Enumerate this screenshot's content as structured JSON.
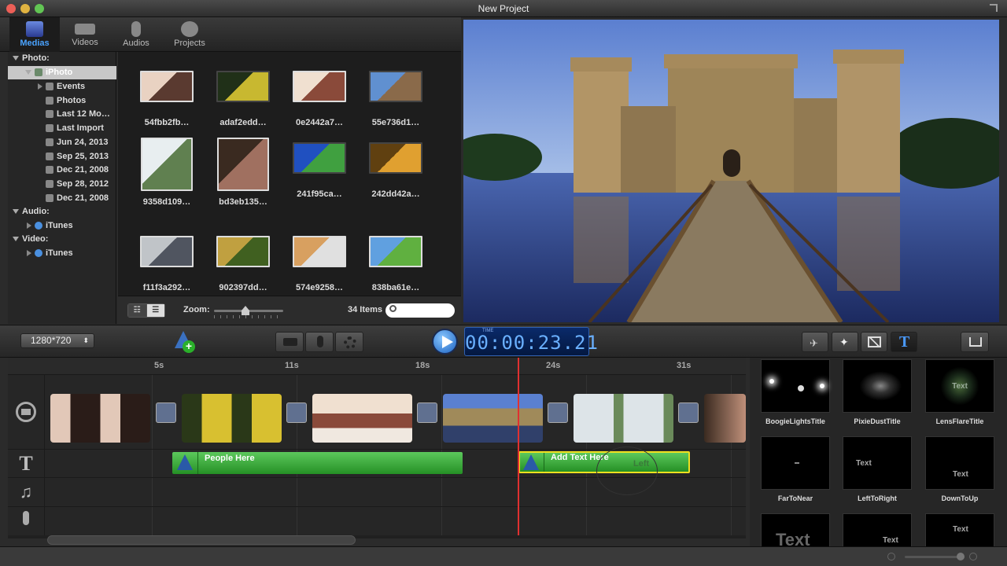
{
  "window": {
    "title": "New Project"
  },
  "library_tabs": [
    {
      "label": "Medias",
      "icon": "photos-icon"
    },
    {
      "label": "Videos",
      "icon": "video-camera-icon"
    },
    {
      "label": "Audios",
      "icon": "microphone-icon"
    },
    {
      "label": "Projects",
      "icon": "film-reel-icon"
    }
  ],
  "tree": {
    "photo_header": "Photo:",
    "iphoto": "iPhoto",
    "iphoto_items": [
      "Events",
      "Photos",
      "Last 12 Mo…",
      "Last Import",
      "Jun 24, 2013",
      "Sep 25, 2013",
      "Dec 21, 2008",
      "Sep 28, 2012",
      "Dec 21, 2008"
    ],
    "audio_header": "Audio:",
    "audio_itunes": "iTunes",
    "video_header": "Video:",
    "video_itunes": "iTunes"
  },
  "media": [
    {
      "name": "54fbb2fb…",
      "colors": [
        "#e9d2c2",
        "#5a3a30"
      ]
    },
    {
      "name": "adaf2edd…",
      "colors": [
        "#203018",
        "#c8b830"
      ]
    },
    {
      "name": "0e2442a7…",
      "colors": [
        "#f0e0d0",
        "#8a4a3a"
      ]
    },
    {
      "name": "55e736d1…",
      "colors": [
        "#6090d0",
        "#8a6a4a"
      ]
    },
    {
      "name": "9358d109…",
      "colors": [
        "#e8eef0",
        "#608050"
      ]
    },
    {
      "name": "bd3eb135…",
      "colors": [
        "#3a2a20",
        "#a07060"
      ]
    },
    {
      "name": "241f95ca…",
      "colors": [
        "#2050c0",
        "#40a040"
      ]
    },
    {
      "name": "242dd42a…",
      "colors": [
        "#604010",
        "#e0a030"
      ]
    },
    {
      "name": "f11f3a292…",
      "colors": [
        "#c0c4c8",
        "#505560"
      ]
    },
    {
      "name": "902397dd…",
      "colors": [
        "#c0a040",
        "#406020"
      ]
    },
    {
      "name": "574e9258…",
      "colors": [
        "#d8a060",
        "#e0e0e0"
      ]
    },
    {
      "name": "838ba61e…",
      "colors": [
        "#60a0e0",
        "#60b040"
      ]
    }
  ],
  "grid_bar": {
    "zoom_label": "Zoom:",
    "zoom_level": 0.45,
    "item_count": "34 Items",
    "search_placeholder": ""
  },
  "toolbar": {
    "resolution": "1280*720",
    "timecode": "00:00:23.21",
    "timecode_caption": "TIME"
  },
  "ruler": [
    "5s",
    "11s",
    "18s",
    "24s",
    "31s"
  ],
  "playhead_time": "00:00:23.21",
  "text_clips": [
    {
      "label": "People Here"
    },
    {
      "label": "Add Text Here",
      "preview": "Left"
    }
  ],
  "titles": [
    {
      "name": "BoogieLightsTitle",
      "sample": ""
    },
    {
      "name": "PixieDustTitle",
      "sample": ""
    },
    {
      "name": "LensFlareTitle",
      "sample": "Text"
    },
    {
      "name": "FarToNear",
      "sample": ""
    },
    {
      "name": "LeftToRight",
      "sample": "Text"
    },
    {
      "name": "DownToUp",
      "sample": "Text"
    },
    {
      "name": "",
      "sample": "Text"
    },
    {
      "name": "",
      "sample": "Text"
    },
    {
      "name": "",
      "sample": "Text"
    }
  ],
  "colors": {
    "accent": "#4aa3ff",
    "text_clip": "#3cb043",
    "selected_clip_border": "#f0e020",
    "playhead": "#e03030"
  }
}
